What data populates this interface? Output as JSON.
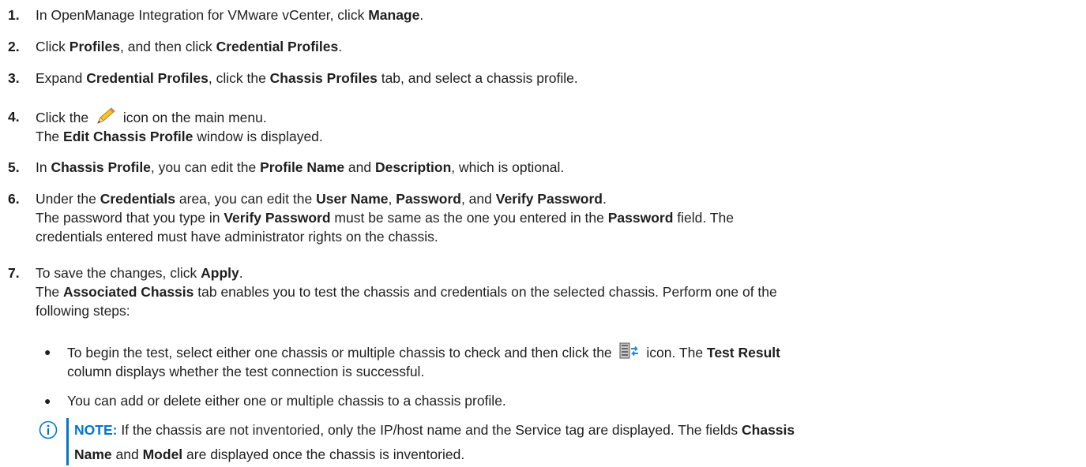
{
  "steps": [
    {
      "num": "1.",
      "t1": "In OpenManage Integration for VMware vCenter, click ",
      "b1": "Manage",
      "t2": "."
    },
    {
      "num": "2.",
      "t1": "Click ",
      "b1": "Profiles",
      "t2": ", and then click ",
      "b2": "Credential Profiles",
      "t3": "."
    },
    {
      "num": "3.",
      "t1": "Expand ",
      "b1": "Credential Profiles",
      "t2": ", click the ",
      "b2": "Chassis Profiles",
      "t3": " tab, and select a chassis profile."
    },
    {
      "num": "4.",
      "t1": "Click the ",
      "t2": " icon on the main menu.",
      "r1": "The ",
      "rb1": "Edit Chassis Profile",
      "r2": " window is displayed."
    },
    {
      "num": "5.",
      "t1": "In ",
      "b1": "Chassis Profile",
      "t2": ", you can edit the ",
      "b2": "Profile Name",
      "t3": " and ",
      "b3": "Description",
      "t4": ", which is optional."
    },
    {
      "num": "6.",
      "t1": "Under the ",
      "b1": "Credentials",
      "t2": " area, you can edit the ",
      "b2": "User Name",
      "t3": ", ",
      "b3": "Password",
      "t4": ", and ",
      "b4": "Verify Password",
      "t5": ".",
      "r1": "The password that you type in ",
      "rb1": "Verify Password",
      "r2": " must be same as the one you entered in the ",
      "rb2": "Password",
      "r3": " field. The",
      "r4": "credentials entered must have administrator rights on the chassis."
    },
    {
      "num": "7.",
      "t1": "To save the changes, click ",
      "b1": "Apply",
      "t2": ".",
      "r1": "The ",
      "rb1": "Associated Chassis",
      "r2": " tab enables you to test the chassis and credentials on the selected chassis. Perform one of the",
      "r3": "following steps:"
    }
  ],
  "bullets": [
    {
      "t1": "To begin the test, select either one chassis or multiple chassis to check and then click the ",
      "t2": " icon. The ",
      "b1": "Test Result",
      "t3": "column displays whether the test connection is successful."
    },
    {
      "t1": "You can add or delete either one or multiple chassis to a chassis profile."
    }
  ],
  "note": {
    "label": "NOTE:",
    "t1": " If the chassis are not inventoried, only the IP/host name and the Service tag are displayed. The fields ",
    "b1": "Chassis",
    "b2": "Name",
    "t2": " and ",
    "b3": "Model",
    "t3": " are displayed once the chassis is inventoried."
  },
  "colors": {
    "accent": "#0076ce",
    "text": "#1f1f1f"
  },
  "icons": [
    "pencil-icon",
    "chassis-test-icon",
    "info-icon"
  ]
}
